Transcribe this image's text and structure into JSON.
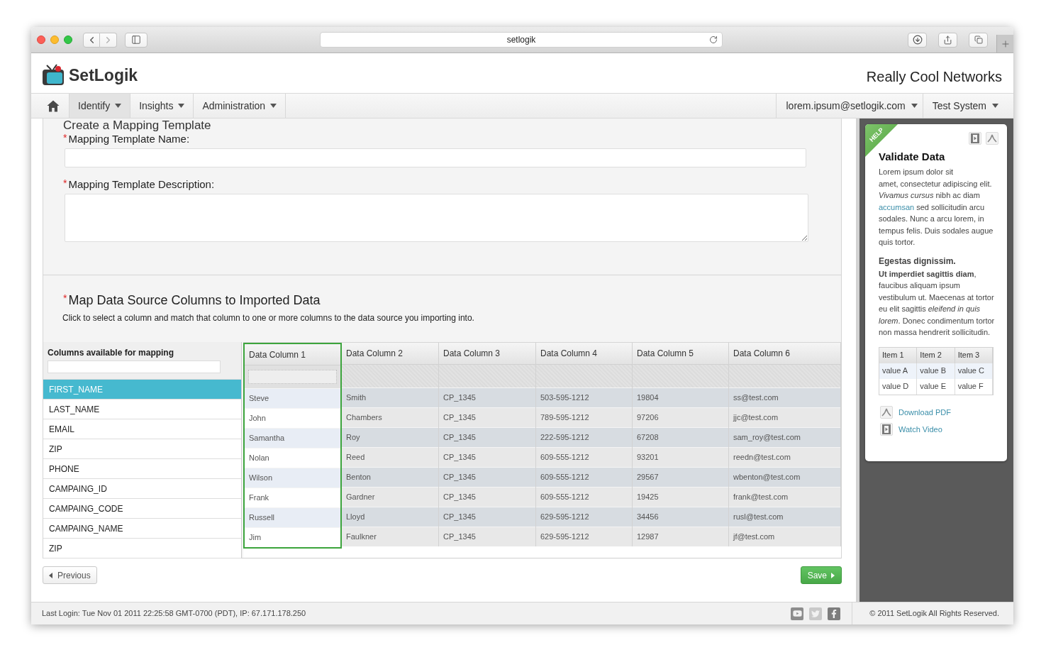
{
  "browser": {
    "address": "setlogik"
  },
  "header": {
    "brand": "SetLogik",
    "company": "Really Cool Networks"
  },
  "nav": {
    "items": [
      {
        "label": "Identify",
        "selected": true
      },
      {
        "label": "Insights",
        "selected": false
      },
      {
        "label": "Administration",
        "selected": false
      }
    ],
    "user_menus": [
      "lorem.ipsum@setlogik.com",
      "Test System"
    ]
  },
  "form": {
    "title": "Create a Mapping Template",
    "fields": [
      {
        "kind": "input",
        "marker": "*",
        "label": "Mapping Template Name:"
      },
      {
        "kind": "textarea",
        "marker": "*",
        "label": "Mapping Template Description:"
      }
    ]
  },
  "mapping": {
    "marker": "*",
    "title": "Map Data Source Columns to Imported Data",
    "instructions": "Click to select a column and match that column to one or more columns to the data source you importing into.",
    "available": {
      "title": "Columns available for mapping",
      "items": [
        {
          "label": "FIRST_NAME",
          "selected": true
        },
        {
          "label": "LAST_NAME",
          "selected": false
        },
        {
          "label": "EMAIL",
          "selected": false
        },
        {
          "label": "ZIP",
          "selected": false
        },
        {
          "label": "PHONE",
          "selected": false
        },
        {
          "label": "CAMPAING_ID",
          "selected": false
        },
        {
          "label": "CAMPAING_CODE",
          "selected": false
        },
        {
          "label": "CAMPAING_NAME",
          "selected": false
        },
        {
          "label": "ZIP",
          "selected": false
        }
      ]
    },
    "table": {
      "columns": [
        {
          "label": "Data Column 1",
          "selected": true
        },
        {
          "label": "Data Column 2",
          "selected": false
        },
        {
          "label": "Data Column 3",
          "selected": false
        },
        {
          "label": "Data Column 4",
          "selected": false
        },
        {
          "label": "Data Column 5",
          "selected": false
        },
        {
          "label": "Data Column 6",
          "selected": false
        }
      ],
      "rows": [
        [
          "Steve",
          "Smith",
          "CP_1345",
          "503-595-1212",
          "19804",
          "ss@test.com"
        ],
        [
          "John",
          "Chambers",
          "CP_1345",
          "789-595-1212",
          "97206",
          "jjc@test.com"
        ],
        [
          "Samantha",
          "Roy",
          "CP_1345",
          "222-595-1212",
          "67208",
          "sam_roy@test.com"
        ],
        [
          "Nolan",
          "Reed",
          "CP_1345",
          "609-555-1212",
          "93201",
          "reedn@test.com"
        ],
        [
          "Wilson",
          "Benton",
          "CP_1345",
          "609-555-1212",
          "29567",
          "wbenton@test.com"
        ],
        [
          "Frank",
          "Gardner",
          "CP_1345",
          "609-555-1212",
          "19425",
          "frank@test.com"
        ],
        [
          "Russell",
          "Lloyd",
          "CP_1345",
          "629-595-1212",
          "34456",
          "rusl@test.com"
        ],
        [
          "Jim",
          "Faulkner",
          "CP_1345",
          "629-595-1212",
          "12987",
          "jf@test.com"
        ]
      ]
    }
  },
  "actions": {
    "previous": "Previous",
    "save": "Save"
  },
  "help": {
    "ribbon": "HELP",
    "title": "Validate Data",
    "paragraph_1": {
      "before": "Lorem ipsum dolor sit\namet, consectetur adipiscing elit. *Vivamus cursus* nibh ac diam",
      "link": "accumsan",
      "after": "sed sollicitudin arcu sodales. Nunc a arcu lorem, in tempus felis. Duis sodales augue quis tortor."
    },
    "subtitle": "Egestas dignissim.",
    "paragraph_2": "**Ut imperdiet sagittis diam**, faucibus aliquam ipsum vestibulum ut. Maecenas at tortor eu elit sagittis *eleifend in quis lorem*. Donec condimentum tortor non massa hendrerit sollicitudin.",
    "table": {
      "columns": [
        "Item 1",
        "Item 2",
        "Item 3"
      ],
      "rows": [
        [
          "value A",
          "value B",
          "value C"
        ],
        [
          "value D",
          "value E",
          "value F"
        ]
      ]
    },
    "links": [
      {
        "kind": "pdf",
        "label": "Download PDF"
      },
      {
        "kind": "video",
        "label": "Watch Video"
      }
    ]
  },
  "footer": {
    "last_login": "Last Login: Tue Nov 01 2011 22:25:58 GMT-0700 (PDT), IP: 67.171.178.250",
    "copyright": "© 2011 SetLogik All Rights Reserved."
  }
}
